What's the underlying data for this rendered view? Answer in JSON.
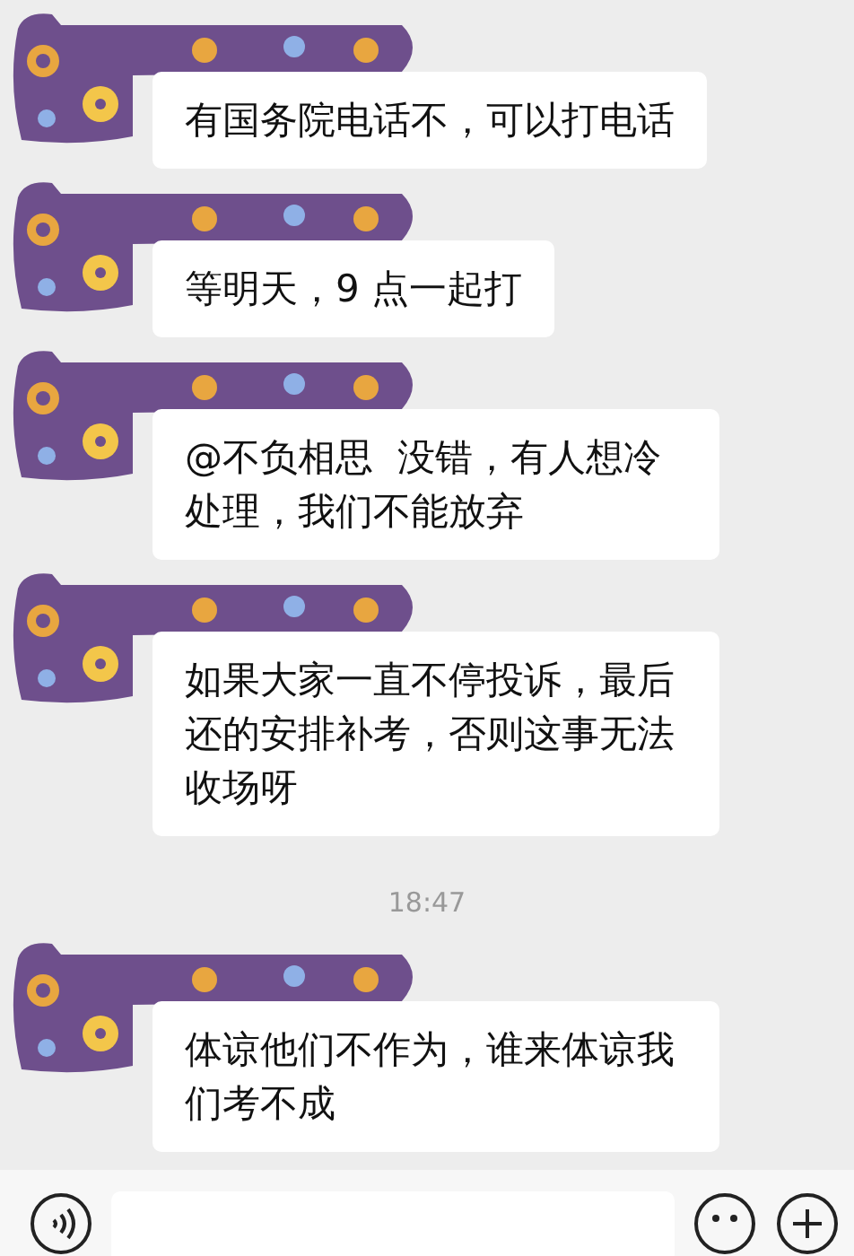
{
  "messages": [
    {
      "kind": "message",
      "text": "有国务院电话不，可以打电话"
    },
    {
      "kind": "message",
      "text": "等明天，9 点一起打"
    },
    {
      "kind": "message",
      "text": "@不负相思  没错，有人想冷处理，我们不能放弃"
    },
    {
      "kind": "message",
      "text": "如果大家一直不停投诉，最后还的安排补考，否则这事无法收场呀"
    },
    {
      "kind": "time",
      "text": "18:47"
    },
    {
      "kind": "message",
      "text": "体谅他们不作为，谁来体谅我们考不成"
    }
  ]
}
